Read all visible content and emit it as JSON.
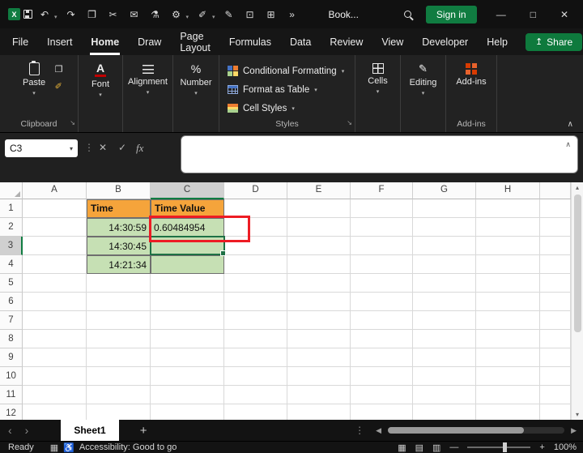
{
  "titlebar": {
    "title": "Book...",
    "signin_label": "Sign in",
    "icons": [
      {
        "name": "excel-logo",
        "css": "logo"
      },
      {
        "name": "save-icon",
        "css": "save"
      },
      {
        "name": "undo-icon",
        "glyph": "↶",
        "caret": true
      },
      {
        "name": "redo-icon",
        "glyph": "↷"
      },
      {
        "name": "copy-icon",
        "glyph": "❐"
      },
      {
        "name": "cut-icon",
        "glyph": "✂"
      },
      {
        "name": "mail-icon",
        "glyph": "✉"
      },
      {
        "name": "beaker-icon",
        "glyph": "⚗"
      },
      {
        "name": "gear-icon",
        "glyph": "⚙",
        "caret": true
      },
      {
        "name": "format-painter-icon",
        "glyph": "✐",
        "caret": true
      },
      {
        "name": "pen-icon",
        "glyph": "✎"
      },
      {
        "name": "inbox-icon",
        "glyph": "⊡"
      },
      {
        "name": "table-icon",
        "glyph": "⊞"
      },
      {
        "name": "overflow-icon",
        "glyph": "»"
      }
    ],
    "window_controls": [
      {
        "name": "minimize-button",
        "glyph": "—"
      },
      {
        "name": "maximize-button",
        "glyph": "□"
      },
      {
        "name": "close-button",
        "glyph": "✕"
      }
    ]
  },
  "menubar": {
    "tabs": [
      {
        "label": "File"
      },
      {
        "label": "Insert"
      },
      {
        "label": "Home",
        "active": true
      },
      {
        "label": "Draw"
      },
      {
        "label": "Page Layout"
      },
      {
        "label": "Formulas"
      },
      {
        "label": "Data"
      },
      {
        "label": "Review"
      },
      {
        "label": "View"
      },
      {
        "label": "Developer"
      },
      {
        "label": "Help"
      }
    ],
    "share_label": "Share"
  },
  "ribbon": {
    "paste_label": "Paste",
    "clipboard_label": "Clipboard",
    "font_label": "Font",
    "alignment_label": "Alignment",
    "number_label": "Number",
    "styles_items": [
      "Conditional Formatting",
      "Format as Table",
      "Cell Styles"
    ],
    "styles_label": "Styles",
    "cells_label": "Cells",
    "editing_label": "Editing",
    "addins_label": "Add-ins",
    "addins_group_label": "Add-ins"
  },
  "formula_bar": {
    "name_box": "C3",
    "fx_label": "fx",
    "input_value": ""
  },
  "grid": {
    "columns": [
      "A",
      "B",
      "C",
      "D",
      "E",
      "F",
      "G",
      "H"
    ],
    "row_count": 12,
    "selected_cell": "C3",
    "selected_column": "C",
    "selected_row": 3,
    "cells": {
      "B1": {
        "text": "Time",
        "type": "header"
      },
      "C1": {
        "text": "Time Value",
        "type": "header"
      },
      "B2": {
        "text": "14:30:59",
        "type": "time"
      },
      "B3": {
        "text": "14:30:45",
        "type": "time"
      },
      "B4": {
        "text": "14:21:34",
        "type": "time"
      },
      "C2": {
        "text": "0.60484954",
        "type": "value"
      },
      "C3": {
        "text": "",
        "type": "value"
      },
      "C4": {
        "text": "",
        "type": "value"
      }
    },
    "colors": {
      "header_orange": "#F5A43B",
      "cell_green": "#C6E0B4",
      "selection_green": "#1E7145",
      "annotation_red": "#ED1C24",
      "excel_green": "#107C41"
    }
  },
  "sheet_bar": {
    "active_tab": "Sheet1",
    "add_label": "+"
  },
  "status_bar": {
    "ready_label": "Ready",
    "accessibility_label": "Accessibility: Good to go",
    "zoom_label": "100%"
  },
  "glyphs": {
    "caret_down": "▾",
    "collapse": "∧",
    "dialog_launcher": "↘",
    "dots_v": "⋮",
    "cancel": "✕",
    "check": "✓",
    "sheet_prev": "‹",
    "sheet_next": "›",
    "scroll_left": "◀",
    "scroll_right": "▶",
    "scroll_up": "▴",
    "scroll_down": "▾",
    "minus": "—",
    "plus": "+",
    "font_icon": "A",
    "number_icon": "%",
    "editing_icon": "✎",
    "copy_icon": "❐",
    "format_painter_icon": "✐",
    "share_icon": "↥",
    "view_normal_icon": "▦",
    "view_layout_icon": "▤",
    "view_break_icon": "▥",
    "macro_icon": "▦",
    "accessibility_icon": "♿"
  }
}
